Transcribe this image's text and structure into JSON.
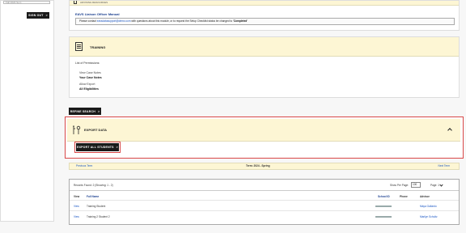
{
  "left": {
    "input_value": "Fall 2024 Sem",
    "signout_label": "SIGN OUT"
  },
  "top_card": {
    "header_text": "ADVISING RESOURCES",
    "manual_link": "EAVS Liaison Officer Manual",
    "notice_prefix": "Please contact ",
    "notice_email": "eavsdatasupport@demo.com",
    "notice_middle": " with questions about this module, or to request the Setup Checklist status be changed to ",
    "notice_status": "'Completed'"
  },
  "training": {
    "title": "TRAINING",
    "perm_title": "List of Permissions:",
    "permissions": [
      {
        "label": "View Case Notes",
        "bold": false
      },
      {
        "label": "Your Case Notes",
        "bold": true
      },
      {
        "label": "Allow Export",
        "bold": false
      },
      {
        "label": "All Eligibilities",
        "bold": true
      }
    ]
  },
  "refine_label": "REFINE SEARCH",
  "export": {
    "title": "EXPORT DATA",
    "button_label": "EXPORT ALL STUDENTS"
  },
  "term_bar": {
    "previous": "Previous Term",
    "current": "Term: 2024 - Spring",
    "next": "Next Term"
  },
  "records": {
    "found": "Records Found: 2   (Showing: 1 - 2)",
    "show_per_page": "Show Per Page:",
    "per_page_value": "100",
    "page_label": "Page: 1",
    "columns": [
      "View",
      "Full Name",
      "School ID",
      "Phone",
      "Advisor"
    ],
    "rows": [
      {
        "view": "View",
        "name": "Training Student",
        "advisor": "Maya Gallardo"
      },
      {
        "view": "View",
        "name": "Training 2 Student 2",
        "advisor": "Marilyn Schultz"
      }
    ]
  }
}
